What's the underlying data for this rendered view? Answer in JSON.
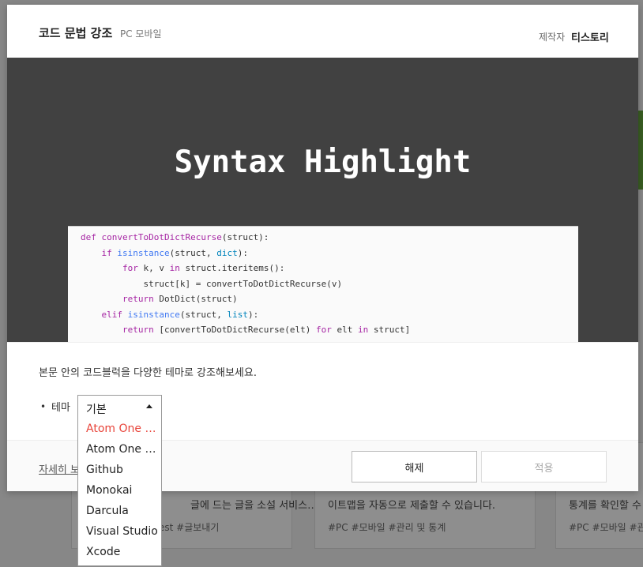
{
  "background": {
    "cards": [
      {
        "text": "글에 드는 글을 소설 서비스…",
        "tags": "est   #글보내기"
      },
      {
        "text": "이트맵을 자동으로 제출할 수 있습니다.",
        "tags": "#PC   #모바일   #관리 및 통계"
      },
      {
        "text": "통계를 확인할 수 있",
        "tags": "#PC   #모바일   #관"
      }
    ]
  },
  "modal": {
    "title": "코드 문법 강조",
    "platform": "PC 모바일",
    "maker_label": "제작자",
    "maker_name": "티스토리",
    "banner_title": "Syntax Highlight",
    "description": "본문 안의 코드블럭을 다양한 테마로 강조해보세요.",
    "theme_label": "테마",
    "detail_link": "자세히 보",
    "cancel_button": "해제",
    "apply_button": "적용"
  },
  "code_lines": [
    {
      "indent": "",
      "parts": [
        [
          "kw",
          "def "
        ],
        [
          "kw",
          "convertToDotDictRecurse"
        ],
        [
          "",
          "(struct):"
        ]
      ]
    },
    {
      "indent": "    ",
      "parts": [
        [
          "kw",
          "if "
        ],
        [
          "fn",
          "isinstance"
        ],
        [
          "",
          "(struct, "
        ],
        [
          "bi",
          "dict"
        ],
        [
          "",
          "):"
        ]
      ]
    },
    {
      "indent": "        ",
      "parts": [
        [
          "kw",
          "for "
        ],
        [
          "",
          "k, v "
        ],
        [
          "kw",
          "in "
        ],
        [
          "",
          "struct.iteritems():"
        ]
      ]
    },
    {
      "indent": "            ",
      "parts": [
        [
          "",
          "struct[k] = convertToDotDictRecurse(v)"
        ]
      ]
    },
    {
      "indent": "        ",
      "parts": [
        [
          "kw",
          "return "
        ],
        [
          "",
          "DotDict(struct)"
        ]
      ]
    },
    {
      "indent": "    ",
      "parts": [
        [
          "kw",
          "elif "
        ],
        [
          "fn",
          "isinstance"
        ],
        [
          "",
          "(struct, "
        ],
        [
          "bi",
          "list"
        ],
        [
          "",
          "):"
        ]
      ]
    },
    {
      "indent": "        ",
      "parts": [
        [
          "kw",
          "return "
        ],
        [
          "",
          "[convertToDotDictRecurse(elt) "
        ],
        [
          "kw",
          "for "
        ],
        [
          "",
          "elt "
        ],
        [
          "kw",
          "in "
        ],
        [
          "",
          "struct]"
        ]
      ]
    }
  ],
  "dropdown": {
    "selected": "기본",
    "options": [
      "Atom One Dark",
      "Atom One Li…",
      "Github",
      "Monokai",
      "Darcula",
      "Visual Studio",
      "Xcode"
    ],
    "highlighted_index": 0
  },
  "colors": {
    "accent_red": "#e8443a",
    "banner_bg": "#414141",
    "keyword": "#a626a4",
    "function": "#4078f2",
    "builtin": "#0184bc"
  }
}
